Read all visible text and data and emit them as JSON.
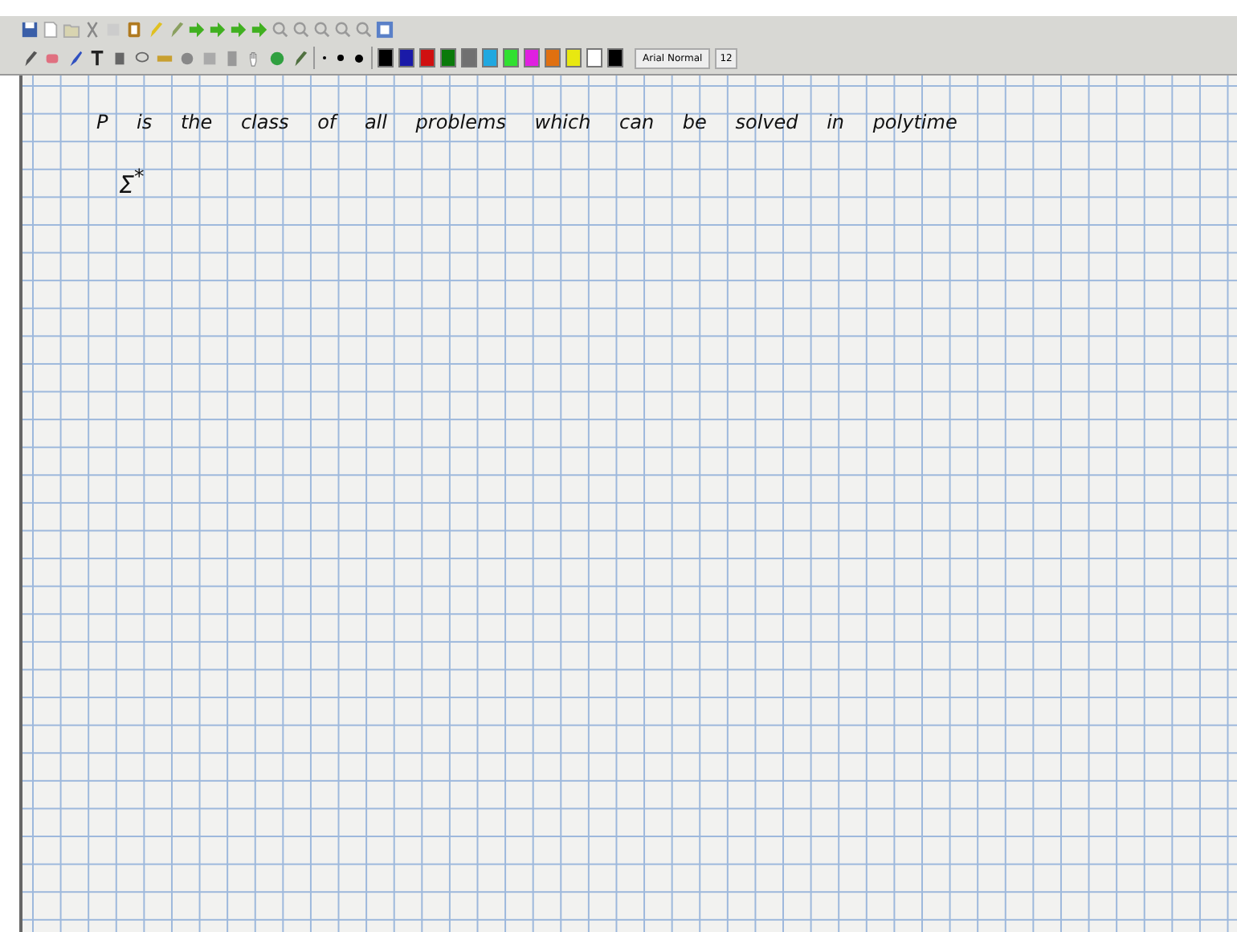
{
  "toolbar": {
    "palette": [
      {
        "color": "#000000",
        "selected": false
      },
      {
        "color": "#1a1aa8",
        "selected": false
      },
      {
        "color": "#d01010",
        "selected": false
      },
      {
        "color": "#0a7a0a",
        "selected": false
      },
      {
        "color": "#707070",
        "selected": false
      },
      {
        "color": "#20a8e0",
        "selected": false
      },
      {
        "color": "#30e030",
        "selected": false
      },
      {
        "color": "#e020e0",
        "selected": false
      },
      {
        "color": "#e07010",
        "selected": false
      },
      {
        "color": "#e8e810",
        "selected": false
      },
      {
        "color": "#ffffff",
        "selected": false
      },
      {
        "color": "#000000",
        "selected": false
      }
    ],
    "font_name": "Arial Normal",
    "font_size": "12"
  },
  "page": {
    "lines": [
      "P is the class of all problems which can be solved in polytime",
      "Σ$^{*}$"
    ]
  }
}
